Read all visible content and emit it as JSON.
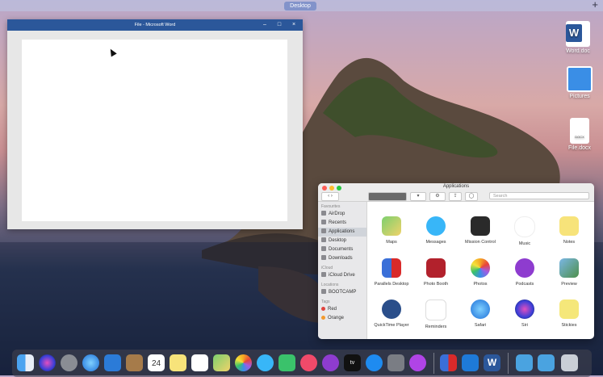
{
  "topbar": {
    "space_label": "Desktop",
    "add_label": "+"
  },
  "word": {
    "title": "File - Microsoft Word",
    "controls": {
      "minimize": "–",
      "maximize": "□",
      "close": "×"
    }
  },
  "desktop_icons": [
    {
      "name": "word-file-icon",
      "label": "Word.doc"
    },
    {
      "name": "pictures-icon",
      "label": "Pictures"
    },
    {
      "name": "docx-file-icon",
      "label": "File.docx",
      "badge": "DOCX"
    }
  ],
  "finder": {
    "title": "Applications",
    "search_placeholder": "Search",
    "sidebar": {
      "favourites_header": "Favourites",
      "favourites": [
        "AirDrop",
        "Recents",
        "Applications",
        "Desktop",
        "Documents",
        "Downloads"
      ],
      "icloud_header": "iCloud",
      "icloud": [
        "iCloud Drive"
      ],
      "locations_header": "Locations",
      "locations": [
        "BOOTCAMP"
      ],
      "tags_header": "Tags",
      "tags": [
        "Red",
        "Orange"
      ]
    },
    "apps": [
      "Maps",
      "Messages",
      "Mission Control",
      "Music",
      "Notes",
      "Parallels Desktop",
      "Photo Booth",
      "Photos",
      "Podcasts",
      "Preview",
      "QuickTime Player",
      "Reminders",
      "Safari",
      "Siri",
      "Stickies"
    ]
  },
  "dock": {
    "calendar_day": "24",
    "appletv_label": "tv",
    "word_label": "W"
  }
}
